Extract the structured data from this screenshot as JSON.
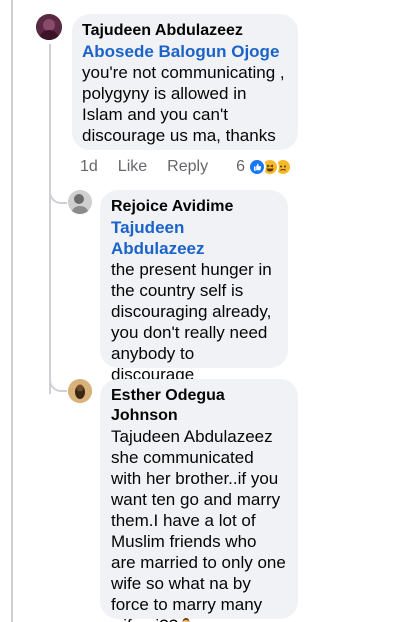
{
  "comment": {
    "author": "Tajudeen Abdulazeez",
    "mention": "Abosede Balogun Ojoge",
    "text": "you're not communicating ,\npolygyny is allowed in\nIslam and you can't\ndiscourage us ma, thanks",
    "time": "1d",
    "like_label": "Like",
    "reply_label": "Reply",
    "reaction_count": "6",
    "reactions": [
      "like-icon",
      "haha-icon",
      "sad-icon"
    ]
  },
  "replies": [
    {
      "author": "Rejoice Avidime",
      "mention": "Tajudeen Abdulazeez",
      "text": "the present hunger in\nthe country self is\ndiscouraging already,\nyou don't really need\nanybody to discourage\nor encourage you"
    },
    {
      "author": "Esther Odegua Johnson",
      "text": "Tajudeen Abdulazeez\nshe communicated\nwith her brother..if you\nwant ten go and marry\nthem.I have a lot of\nMuslim friends who\nare married to only one\nwife so what na by\nforce to marry many\nwife ni??",
      "trailing_emoji": "person-gesturing-icon"
    }
  ],
  "colors": {
    "bubble": "#f0f2f5",
    "mention": "#1b63c9",
    "meta": "#65676b",
    "thread_line": "#ced0d4"
  }
}
